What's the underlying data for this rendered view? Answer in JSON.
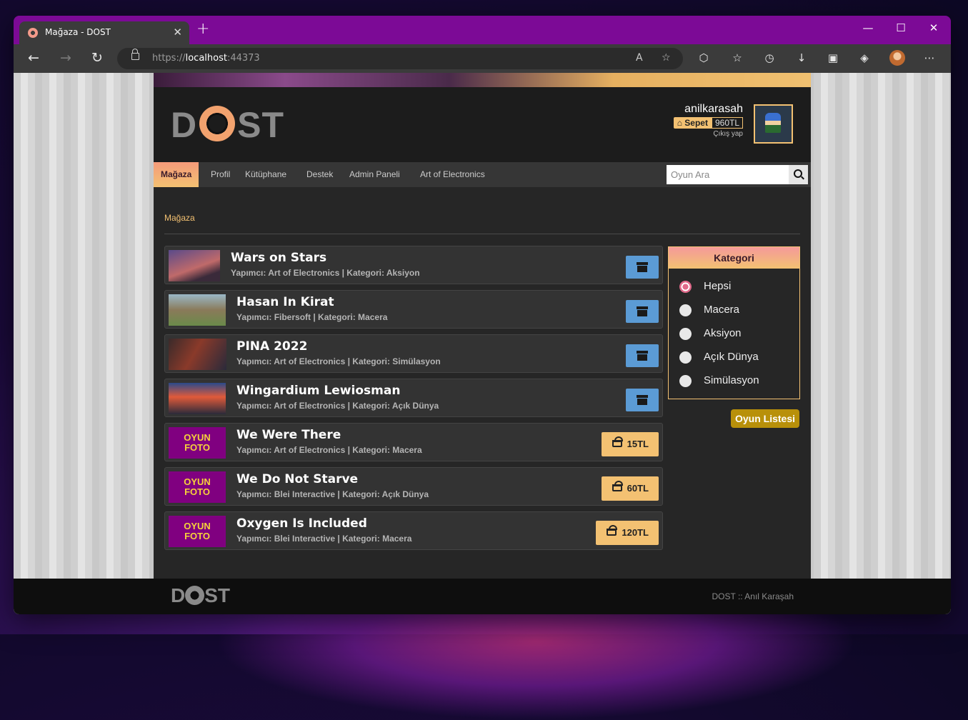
{
  "browser": {
    "tab_title": "Mağaza - DOST",
    "new_tab": "+",
    "url_scheme": "https://",
    "url_host": "localhost",
    "url_port": ":44373",
    "controls": {
      "minimize": "—",
      "maximize": "☐",
      "close": "✕"
    }
  },
  "site": {
    "logo_left": "D",
    "logo_right": "ST",
    "user": {
      "username": "anilkarasah",
      "cart_label": "Sepet",
      "cart_amount": "960TL",
      "logout": "Çıkış yap"
    },
    "nav": [
      {
        "label": "Mağaza",
        "active": true
      },
      {
        "label": "Profil"
      },
      {
        "label": "Kütüphane"
      },
      {
        "label": "Destek"
      },
      {
        "label": "Admin Paneli"
      },
      {
        "label": "Art of Electronics"
      }
    ],
    "search": {
      "placeholder": "Oyun Ara"
    },
    "breadcrumb": "Mağaza",
    "games": [
      {
        "title": "Wars on Stars",
        "meta": "Yapımcı: Art of Electronics | Kategori: Aksiyon",
        "owned": true
      },
      {
        "title": "Hasan In Kirat",
        "meta": "Yapımcı: Fibersoft | Kategori: Macera",
        "owned": true
      },
      {
        "title": "PINA 2022",
        "meta": "Yapımcı: Art of Electronics | Kategori: Simülasyon",
        "owned": true
      },
      {
        "title": "Wingardium Lewiosman",
        "meta": "Yapımcı: Art of Electronics | Kategori: Açık Dünya",
        "owned": true
      },
      {
        "title": "We Were There",
        "meta": "Yapımcı: Art of Electronics | Kategori: Macera",
        "owned": false,
        "price": "15TL",
        "placeholder": "OYUN FOTO"
      },
      {
        "title": "We Do Not Starve",
        "meta": "Yapımcı: Blei Interactive | Kategori: Açık Dünya",
        "owned": false,
        "price": "60TL",
        "placeholder": "OYUN FOTO"
      },
      {
        "title": "Oxygen Is Included",
        "meta": "Yapımcı: Blei Interactive | Kategori: Macera",
        "owned": false,
        "price": "120TL",
        "placeholder": "OYUN FOTO"
      }
    ],
    "category": {
      "title": "Kategori",
      "options": [
        "Hepsi",
        "Macera",
        "Aksiyon",
        "Açık Dünya",
        "Simülasyon"
      ],
      "selected": "Hepsi"
    },
    "game_list_button": "Oyun Listesi",
    "footer": {
      "logo_left": "D",
      "logo_right": "ST",
      "text": "DOST :: Anıl Karaşah"
    }
  },
  "colors": {
    "accent": "#f3c172",
    "tab_strip": "#7c0a96",
    "archive_button": "#5b9bd5",
    "placeholder_bg": "#800080",
    "placeholder_text": "#f6d23a"
  }
}
